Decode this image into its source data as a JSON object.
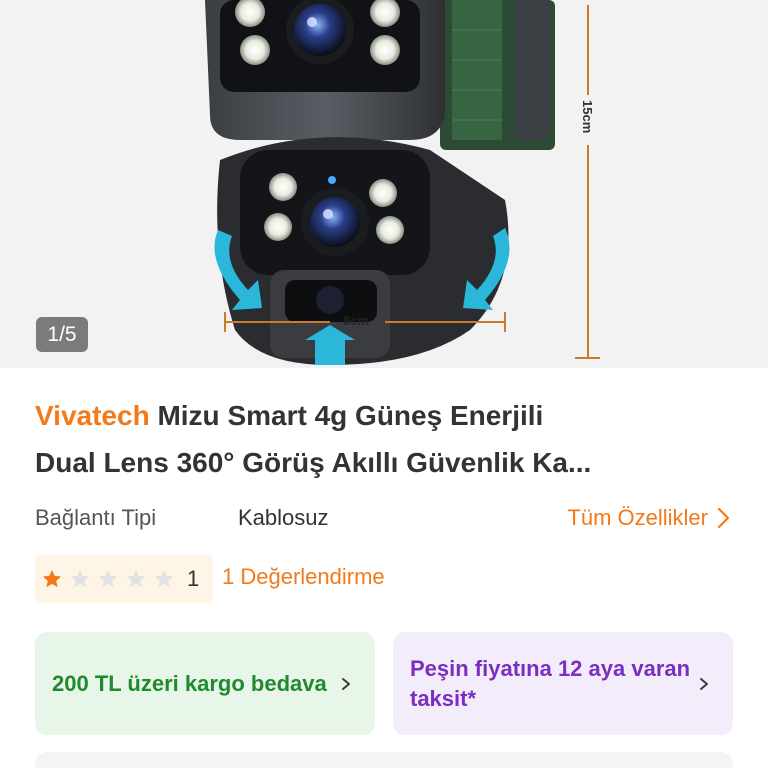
{
  "gallery": {
    "counter": "1/5",
    "dimension_height": "15cm",
    "dimension_width": "8cm"
  },
  "product": {
    "brand": "Vivatech",
    "title_line1": "Mizu Smart 4g Güneş Enerjili",
    "title_line2": "Dual Lens 360° Görüş Akıllı Güvenlik Ka..."
  },
  "attributes": {
    "label": "Bağlantı Tipi",
    "value": "Kablosuz",
    "all_specs_link": "Tüm Özellikler"
  },
  "rating": {
    "score_value": 1,
    "score_text": "1",
    "max_stars": 5,
    "reviews_link": "1 Değerlendirme"
  },
  "promos": {
    "shipping": "200 TL üzeri kargo bedava",
    "installment": "Peşin fiyatına 12 aya varan taksit*"
  },
  "colors": {
    "accent": "#f27a1a",
    "shipping_bg": "#e8f6ea",
    "shipping_text": "#1f8a2e",
    "installment_bg": "#f3ecfb",
    "installment_text": "#7a2fc1",
    "star_empty": "#e2e2e2"
  },
  "icons": {
    "chevron": "chevron-right-icon",
    "star": "star-icon"
  }
}
